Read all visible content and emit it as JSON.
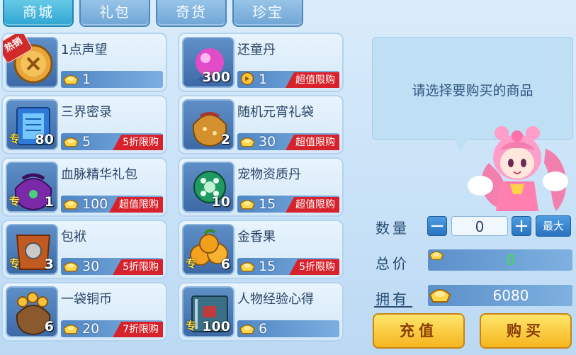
{
  "tabs": [
    {
      "label": "商城",
      "active": true
    },
    {
      "label": "礼包",
      "active": false
    },
    {
      "label": "奇货",
      "active": false
    },
    {
      "label": "珍宝",
      "active": false
    }
  ],
  "items": [
    {
      "name": "1点声望",
      "price": "1",
      "count": "",
      "special": false,
      "hot": true,
      "hot_label": "热销",
      "sale": "",
      "currency": "gold-ingot",
      "icon": "coin-medal-icon"
    },
    {
      "name": "还童丹",
      "price": "1",
      "count": "300",
      "special": false,
      "hot": false,
      "sale": "超值限购",
      "currency": "gold-coin",
      "icon": "pink-pearl-icon"
    },
    {
      "name": "三界密录",
      "price": "5",
      "count": "80",
      "special": true,
      "hot": false,
      "sale": "5折限购",
      "currency": "gold-ingot",
      "icon": "blue-book-icon"
    },
    {
      "name": "随机元宵礼袋",
      "price": "30",
      "count": "2",
      "special": false,
      "hot": false,
      "sale": "超值限购",
      "currency": "gold-ingot",
      "icon": "gift-bag-icon"
    },
    {
      "name": "血脉精华礼包",
      "price": "100",
      "count": "1",
      "special": true,
      "hot": false,
      "sale": "超值限购",
      "currency": "gold-ingot",
      "icon": "purple-bag-icon"
    },
    {
      "name": "宠物资质丹",
      "price": "15",
      "count": "10",
      "special": false,
      "hot": false,
      "sale": "超值限购",
      "currency": "gold-ingot",
      "icon": "green-orb-icon"
    },
    {
      "name": "包袱",
      "price": "30",
      "count": "3",
      "special": true,
      "hot": false,
      "sale": "5折限购",
      "currency": "gold-ingot",
      "icon": "leather-pouch-icon"
    },
    {
      "name": "金香果",
      "price": "15",
      "count": "6",
      "special": true,
      "hot": false,
      "sale": "5折限购",
      "currency": "gold-ingot",
      "icon": "golden-fruit-icon"
    },
    {
      "name": "一袋铜币",
      "price": "20",
      "count": "6",
      "special": false,
      "hot": false,
      "sale": "7折限购",
      "currency": "gold-ingot",
      "icon": "coin-bag-icon"
    },
    {
      "name": "人物经验心得",
      "price": "6",
      "count": "100",
      "special": true,
      "hot": false,
      "sale": "",
      "currency": "gold-ingot",
      "icon": "exp-book-icon"
    }
  ],
  "special_label": "专",
  "panel": {
    "prompt": "请选择要购买的商品",
    "quantity_label": "数量",
    "quantity_value": "0",
    "minus": "−",
    "plus": "+",
    "max_label": "最大",
    "total_label": "总价",
    "total_value": "0",
    "owned_label": "拥有",
    "owned_value": "6080",
    "recharge_label": "充值",
    "buy_label": "购买"
  },
  "colors": {
    "accent_tab": "#2ea6d2",
    "sale_red": "#d8222b",
    "total_green": "#3ee23e",
    "button_gold": "#f5b51f"
  }
}
